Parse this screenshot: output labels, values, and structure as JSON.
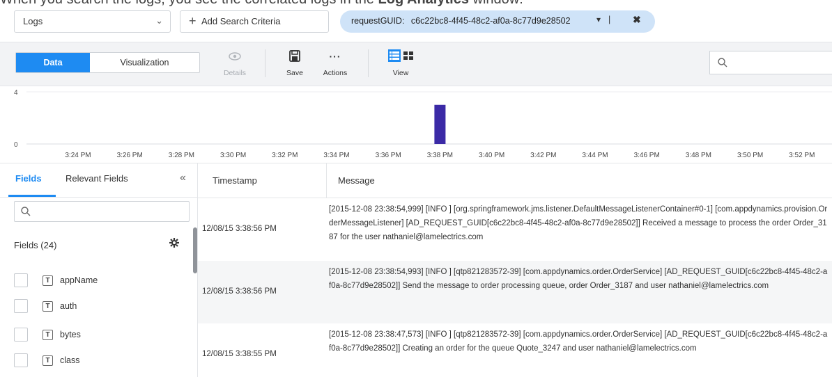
{
  "caption": {
    "text_before": "When you search the logs, you see the correlated logs in the ",
    "bold": "Log Analytics",
    "text_after": " window:"
  },
  "search_bar": {
    "source_select": "Logs",
    "add_criteria_label": "Add Search Criteria",
    "criteria": {
      "key": "requestGUID:",
      "value": "c6c22bc8-4f45-48c2-af0a-8c77d9e28502"
    }
  },
  "toolbar": {
    "data_label": "Data",
    "visualization_label": "Visualization",
    "details_label": "Details",
    "save_label": "Save",
    "actions_label": "Actions",
    "view_label": "View",
    "search_placeholder": ""
  },
  "chart_data": {
    "type": "bar",
    "ylim": [
      0,
      4
    ],
    "yticks": [
      "4",
      "0"
    ],
    "xticks": [
      "3:24 PM",
      "3:26 PM",
      "3:28 PM",
      "3:30 PM",
      "3:32 PM",
      "3:34 PM",
      "3:36 PM",
      "3:38 PM",
      "3:40 PM",
      "3:42 PM",
      "3:44 PM",
      "3:46 PM",
      "3:48 PM",
      "3:50 PM",
      "3:52 PM"
    ],
    "bars": [
      {
        "x": "3:38 PM",
        "value": 3
      }
    ],
    "bar_color": "#3b2aa6",
    "grid": true
  },
  "left_panel": {
    "tab_fields": "Fields",
    "tab_relevant": "Relevant Fields",
    "collapse_glyph": "«",
    "search_placeholder": "",
    "fields_header": "Fields (24)",
    "fields": [
      {
        "type": "T",
        "name": "appName"
      },
      {
        "type": "T",
        "name": "auth"
      },
      {
        "type": "T",
        "name": "bytes"
      },
      {
        "type": "T",
        "name": "class"
      }
    ]
  },
  "table": {
    "columns": [
      "Timestamp",
      "Message"
    ],
    "rows": [
      {
        "timestamp": "12/08/15 3:38:56 PM",
        "message": "[2015-12-08 23:38:54,999] [INFO ] [org.springframework.jms.listener.DefaultMessageListenerContainer#0-1] [com.appdynamics.provision.OrderMessageListener] [AD_REQUEST_GUID[c6c22bc8-4f45-48c2-af0a-8c77d9e28502]] Received a message to process the order Order_3187 for the user nathaniel@lamelectrics.com"
      },
      {
        "timestamp": "12/08/15 3:38:56 PM",
        "message": "[2015-12-08 23:38:54,993] [INFO ] [qtp821283572-39] [com.appdynamics.order.OrderService] [AD_REQUEST_GUID[c6c22bc8-4f45-48c2-af0a-8c77d9e28502]] Send the message to order processing queue, order Order_3187 and user nathaniel@lamelectrics.com"
      },
      {
        "timestamp": "12/08/15 3:38:55 PM",
        "message": "[2015-12-08 23:38:47,573] [INFO ] [qtp821283572-39] [com.appdynamics.order.OrderService] [AD_REQUEST_GUID[c6c22bc8-4f45-48c2-af0a-8c77d9e28502]] Creating an order for the queue Quote_3247 and user nathaniel@lamelectrics.com"
      }
    ]
  }
}
